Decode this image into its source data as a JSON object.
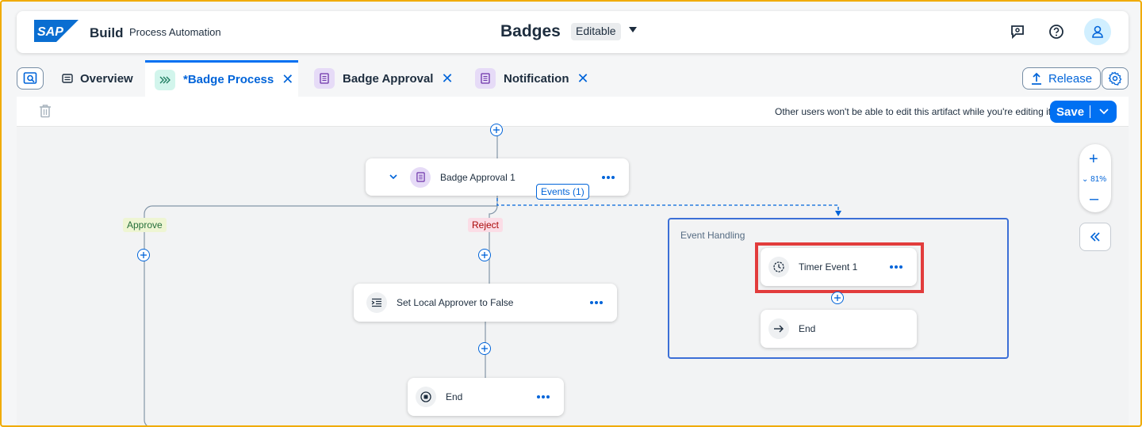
{
  "shell": {
    "logo_text": "SAP",
    "product": "Build",
    "product_sub": "Process Automation",
    "title": "Badges",
    "status": "Editable",
    "icons": [
      "feedback-icon",
      "help-icon",
      "user-icon"
    ]
  },
  "tabs": [
    {
      "label": "Overview",
      "icon": "overview-icon"
    },
    {
      "label": "*Badge Process",
      "icon": "process-icon",
      "active": true
    },
    {
      "label": "Badge Approval",
      "icon": "form-icon"
    },
    {
      "label": "Notification",
      "icon": "form-icon"
    }
  ],
  "actions": {
    "release_label": "Release"
  },
  "toolbar": {
    "lock_message": "Other users won't be able to edit this artifact while you're editing it.",
    "save_label": "Save"
  },
  "canvas": {
    "approval_node": "Badge Approval 1",
    "events_tag": "Events (1)",
    "branch_approve": "Approve",
    "branch_reject": "Reject",
    "set_local_node": "Set Local Approver to False",
    "end_node": "End",
    "event_handling_title": "Event Handling",
    "timer_node": "Timer Event 1",
    "event_end_node": "End",
    "zoom_level": "81%"
  },
  "colors": {
    "accent": "#0070f2",
    "highlight": "#e23c3c",
    "approve_bg": "#eef5d3",
    "reject_bg": "#fbdde6"
  }
}
